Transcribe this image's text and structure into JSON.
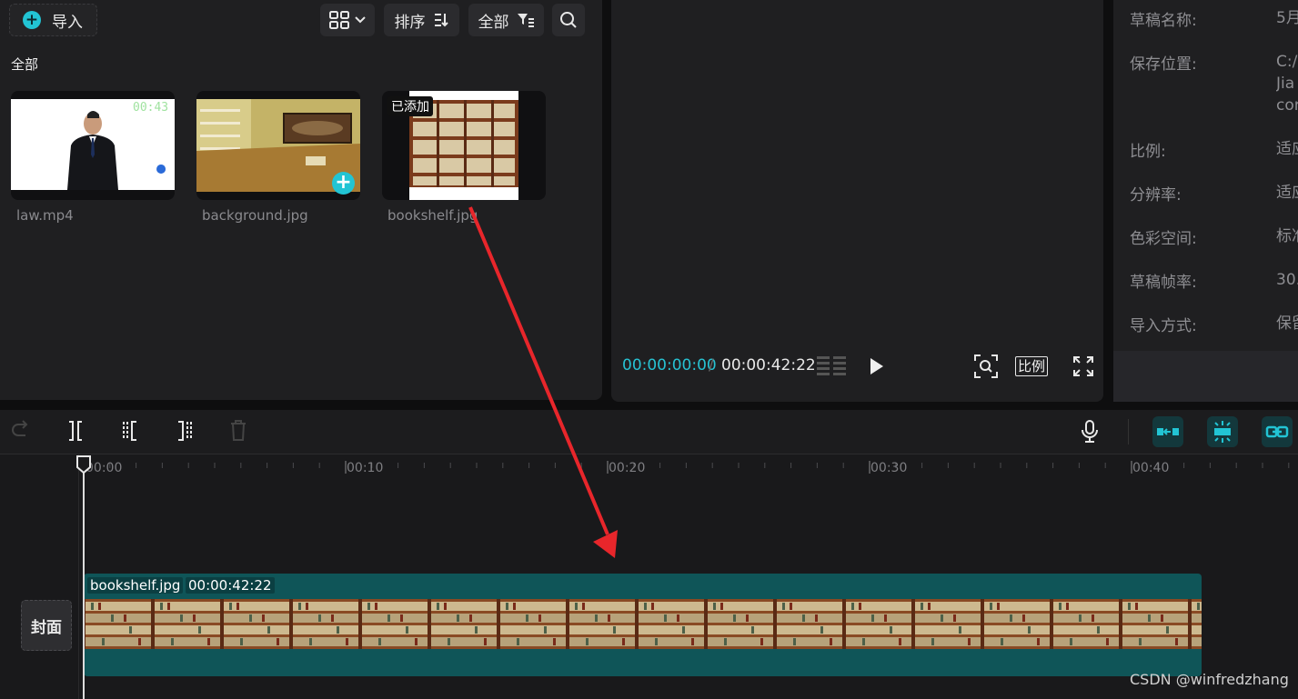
{
  "media": {
    "import_label": "导入",
    "sort_label": "排序",
    "filter_label": "全部",
    "tab_all": "全部",
    "items": [
      {
        "name": "law.mp4",
        "overlay": "00:43"
      },
      {
        "name": "background.jpg"
      },
      {
        "name": "bookshelf.jpg",
        "badge": "已添加"
      }
    ]
  },
  "preview": {
    "current_time": "00:00:00:00",
    "separator": "/",
    "total_time": "00:00:42:22",
    "ratio_label": "比例"
  },
  "properties": {
    "rows": [
      {
        "label": "草稿名称:",
        "value": "5月"
      },
      {
        "label": "保存位置:",
        "value": "C:/",
        "value2": "Jia",
        "value3": "cor"
      },
      {
        "label": "比例:",
        "value": "适应"
      },
      {
        "label": "分辨率:",
        "value": "适应"
      },
      {
        "label": "色彩空间:",
        "value": "标准"
      },
      {
        "label": "草稿帧率:",
        "value": "30."
      },
      {
        "label": "导入方式:",
        "value": "保留"
      }
    ]
  },
  "timeline": {
    "ticks": [
      "00:00",
      "00:10",
      "00:20",
      "00:30",
      "00:40"
    ],
    "cover_label": "封面",
    "clip": {
      "name": "bookshelf.jpg",
      "duration": "00:00:42:22"
    }
  },
  "colors": {
    "accent": "#22c4d4",
    "clip_bg": "#0f5558",
    "arrow": "#e8262b"
  },
  "watermark": "CSDN @winfredzhang"
}
